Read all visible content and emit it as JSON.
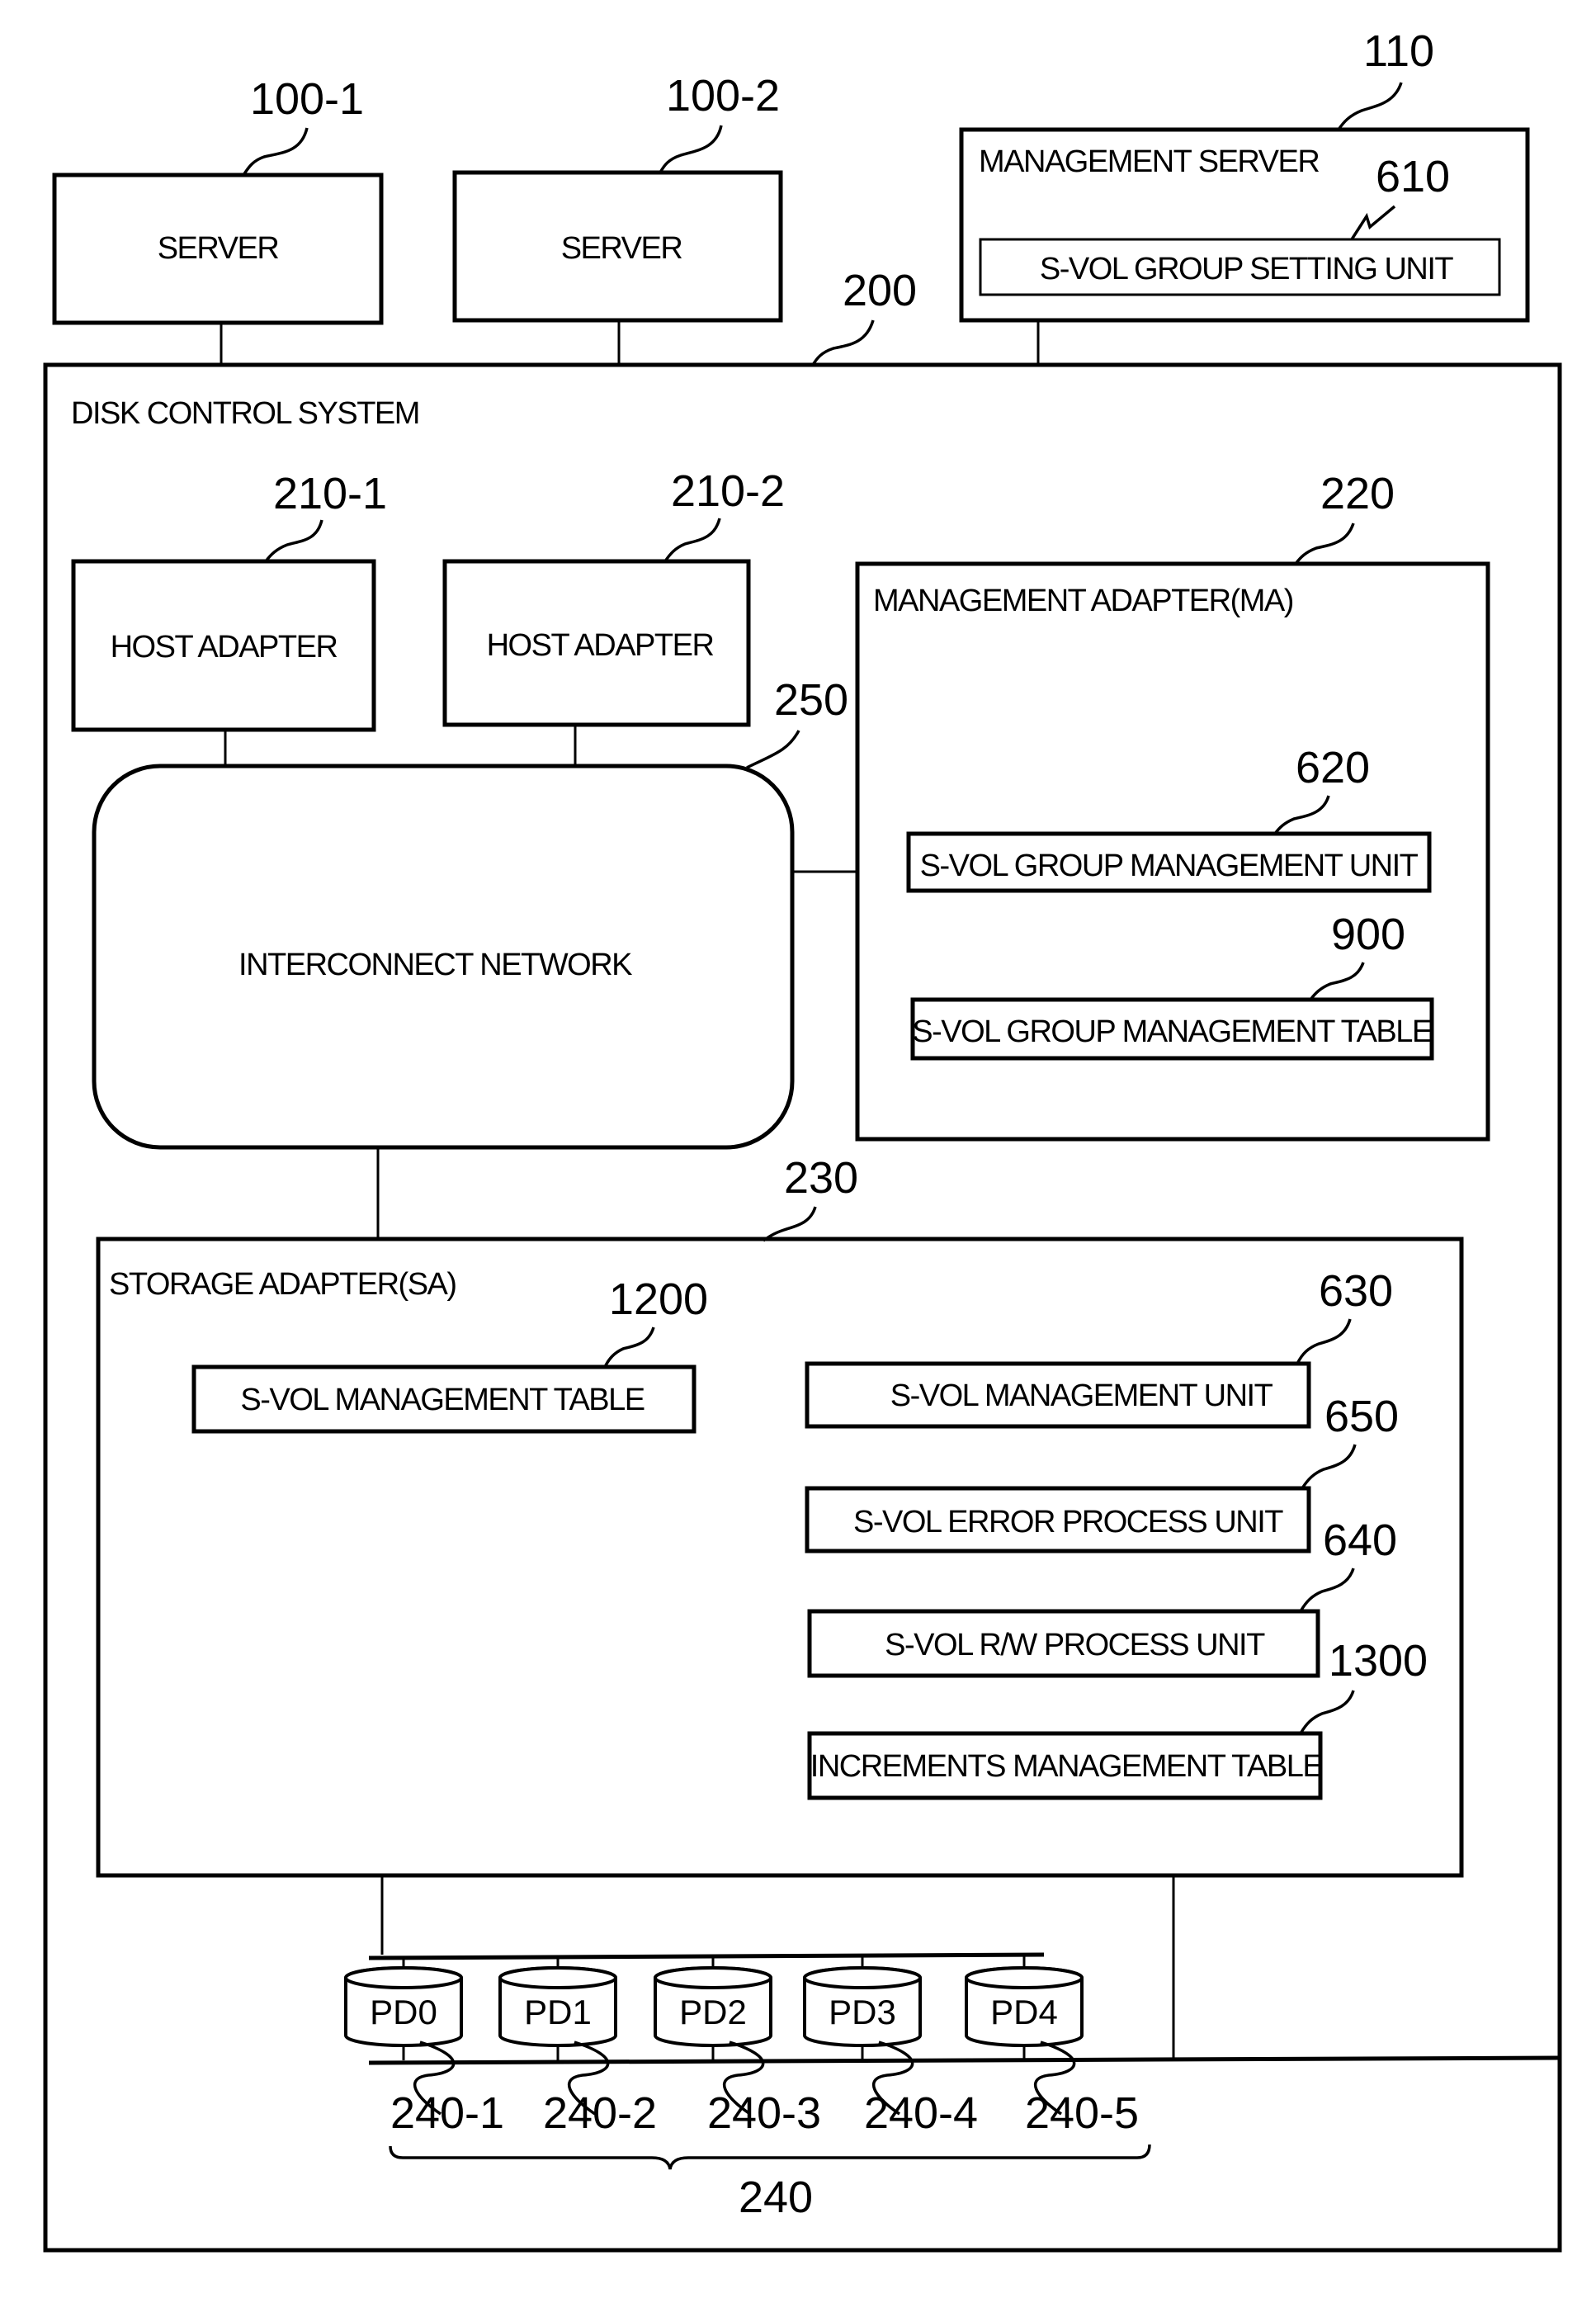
{
  "servers": [
    {
      "ref": "100-1",
      "label": "SERVER"
    },
    {
      "ref": "100-2",
      "label": "SERVER"
    }
  ],
  "management_server": {
    "ref": "110",
    "label": "MANAGEMENT SERVER",
    "setting_unit": {
      "ref": "610",
      "label": "S-VOL GROUP SETTING UNIT"
    }
  },
  "disk_control_system": {
    "ref": "200",
    "label": "DISK CONTROL SYSTEM",
    "host_adapters": [
      {
        "ref": "210-1",
        "label": "HOST ADAPTER"
      },
      {
        "ref": "210-2",
        "label": "HOST ADAPTER"
      }
    ],
    "interconnect": {
      "ref": "250",
      "label": "INTERCONNECT NETWORK"
    },
    "management_adapter": {
      "ref": "220",
      "label": "MANAGEMENT ADAPTER(MA)",
      "units": [
        {
          "ref": "620",
          "label": "S-VOL GROUP MANAGEMENT UNIT"
        },
        {
          "ref": "900",
          "label": "S-VOL GROUP MANAGEMENT TABLE"
        }
      ]
    },
    "storage_adapter": {
      "ref": "230",
      "label": "STORAGE ADAPTER(SA)",
      "table": {
        "ref": "1200",
        "label": "S-VOL MANAGEMENT TABLE"
      },
      "units": [
        {
          "ref": "630",
          "label": "S-VOL  MANAGEMENT UNIT"
        },
        {
          "ref": "650",
          "label": "S-VOL ERROR PROCESS UNIT"
        },
        {
          "ref": "640",
          "label": "S-VOL R/W PROCESS UNIT"
        },
        {
          "ref": "1300",
          "label": "INCREMENTS MANAGEMENT TABLE"
        }
      ]
    },
    "disks": {
      "group_ref": "240",
      "items": [
        {
          "label": "PD0",
          "ref": "240-1"
        },
        {
          "label": "PD1",
          "ref": "240-2"
        },
        {
          "label": "PD2",
          "ref": "240-3"
        },
        {
          "label": "PD3",
          "ref": "240-4"
        },
        {
          "label": "PD4",
          "ref": "240-5"
        }
      ]
    }
  }
}
